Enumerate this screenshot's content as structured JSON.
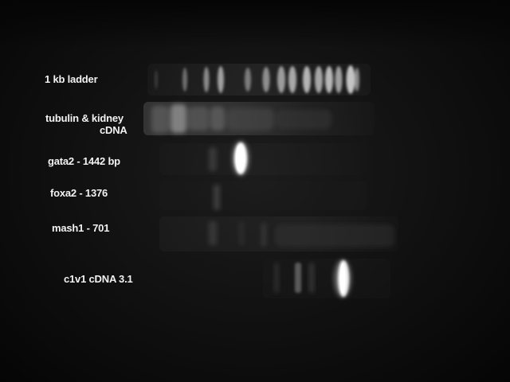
{
  "lanes": [
    {
      "label": "1 kb ladder"
    },
    {
      "label_line1": "tubulin & kidney",
      "label_line2": "cDNA"
    },
    {
      "label": "gata2 - 1442 bp"
    },
    {
      "label": "foxa2 - 1376"
    },
    {
      "label": "mash1 - 701"
    },
    {
      "label": "c1v1 cDNA 3.1"
    }
  ]
}
